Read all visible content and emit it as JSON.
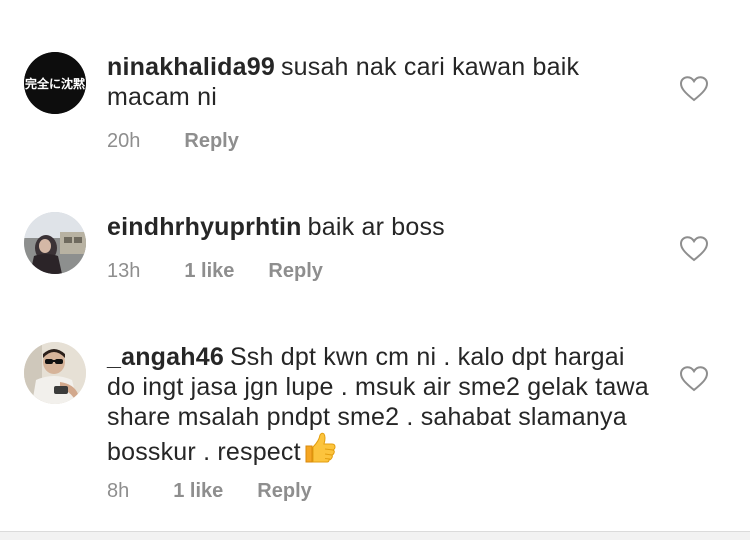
{
  "comments": [
    {
      "avatar_text": "完全に沈黙",
      "username": "ninakhalida99",
      "text": "susah nak cari kawan baik macam ni",
      "time": "20h",
      "likes": "",
      "reply_label": "Reply"
    },
    {
      "username": "eindhrhyuprhtin",
      "text": "baik ar boss",
      "time": "13h",
      "likes": "1 like",
      "reply_label": "Reply"
    },
    {
      "username": "_angah46",
      "text": "Ssh dpt kwn cm ni . kalo dpt hargai do ingt jasa jgn lupe . msuk air sme2 gelak tawa share msalah pndpt sme2 . sahabat slamanya bosskur . respect",
      "emoji": "thumbs-up-emoji",
      "time": "8h",
      "likes": "1 like",
      "reply_label": "Reply"
    }
  ],
  "icons": {
    "like": "heart-outline-icon"
  },
  "colors": {
    "text": "#262626",
    "meta": "#8e8e8e",
    "heart": "#8e8e8e"
  }
}
